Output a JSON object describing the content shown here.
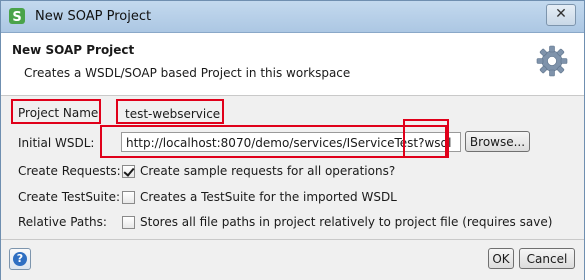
{
  "window": {
    "title": "New SOAP Project",
    "close_glyph": "✕",
    "icon": "soapui-app-icon"
  },
  "header": {
    "title": "New SOAP Project",
    "description": "Creates a WSDL/SOAP based Project in this workspace",
    "icon": "gear-icon"
  },
  "form": {
    "project_name_label": "Project Name:",
    "project_name_value": "test-webservice",
    "initial_wsdl_label": "Initial WSDL:",
    "initial_wsdl_value": "http://localhost:8070/demo/services/IServiceTest?wsdl",
    "browse_label": "Browse...",
    "create_requests_label": "Create Requests:",
    "create_requests_text": "Create sample requests for all operations?",
    "create_requests_checked": true,
    "create_testsuite_label": "Create TestSuite:",
    "create_testsuite_text": "Creates a TestSuite for the imported WSDL",
    "create_testsuite_checked": false,
    "relative_paths_label": "Relative Paths:",
    "relative_paths_text": "Stores all file paths in project relatively to project file (requires save)",
    "relative_paths_checked": false
  },
  "footer": {
    "help_glyph": "?",
    "ok_label": "OK",
    "cancel_label": "Cancel"
  },
  "colors": {
    "highlight": "#e0001a",
    "accent": "#2f6fc2"
  }
}
